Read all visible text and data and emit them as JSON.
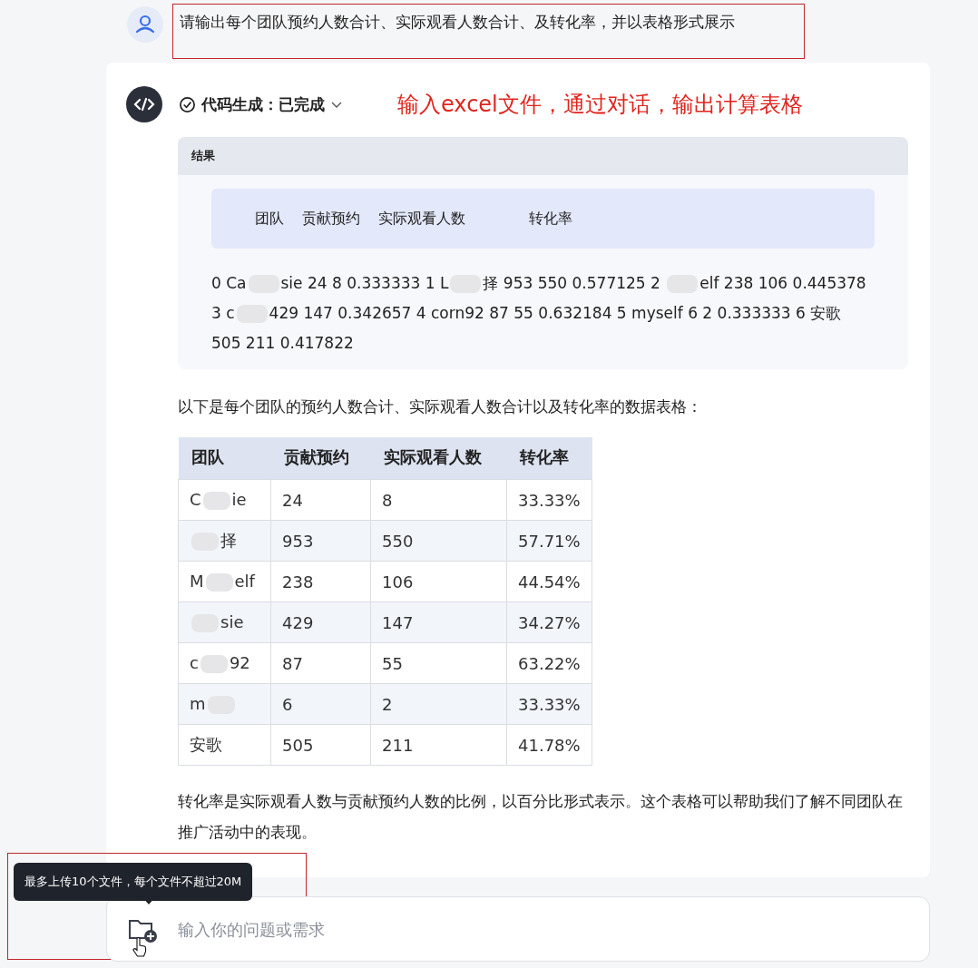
{
  "user_message": {
    "text": "请输出每个团队预约人数合计、实际观看人数合计、及转化率，并以表格形式展示",
    "highlighted": true
  },
  "status": {
    "label": "代码生成：已完成",
    "done": true
  },
  "annotation": "输入excel文件，通过对话，输出计算表格",
  "result": {
    "title": "结果",
    "columns": [
      "团队",
      "贡献预约",
      "实际观看人数",
      "转化率"
    ],
    "segments": [
      {
        "kind": "text",
        "text": "0 Ca"
      },
      {
        "kind": "redacted"
      },
      {
        "kind": "text",
        "text": "sie 24 8 0.333333 1 L"
      },
      {
        "kind": "redacted"
      },
      {
        "kind": "text",
        "text": "择 953 550 0.577125 2 "
      },
      {
        "kind": "redacted"
      },
      {
        "kind": "text",
        "text": "elf 238 106 0.445378 3 c"
      },
      {
        "kind": "redacted"
      },
      {
        "kind": "text",
        "text": "429 147 0.342657 4 corn92 87 55 0.632184 5 myself 6 2 0.333333 6 安歌 505 211 0.417822"
      }
    ]
  },
  "intro": "以下是每个团队的预约人数合计、实际观看人数合计以及转化率的数据表格：",
  "table": {
    "columns": [
      "团队",
      "贡献预约",
      "实际观看人数",
      "转化率"
    ],
    "rows": [
      {
        "kind": "middle",
        "cells": [
          "C ie",
          "24",
          "8",
          "33.33%"
        ]
      },
      {
        "kind": "start",
        "cells": [
          "择",
          "953",
          "550",
          "57.71%"
        ]
      },
      {
        "kind": "middle",
        "cells": [
          "M elf",
          "238",
          "106",
          "44.54%"
        ]
      },
      {
        "kind": "start",
        "cells": [
          "sie",
          "429",
          "147",
          "34.27%"
        ]
      },
      {
        "kind": "middle",
        "cells": [
          "c 92",
          "87",
          "55",
          "63.22%"
        ]
      },
      {
        "kind": "end",
        "cells": [
          "m",
          "6",
          "2",
          "33.33%"
        ]
      },
      {
        "kind": "plain",
        "cells": [
          "安歌",
          "505",
          "211",
          "41.78%"
        ]
      }
    ]
  },
  "conclusion": "转化率是实际观看人数与贡献预约人数的比例，以百分比形式表示。这个表格可以帮助我们了解不同团队在推广活动中的表现。",
  "tooltip": {
    "text": "最多上传10个文件，每个文件不超过20M",
    "highlighted": true
  },
  "input": {
    "placeholder": "输入你的问题或需求"
  }
}
